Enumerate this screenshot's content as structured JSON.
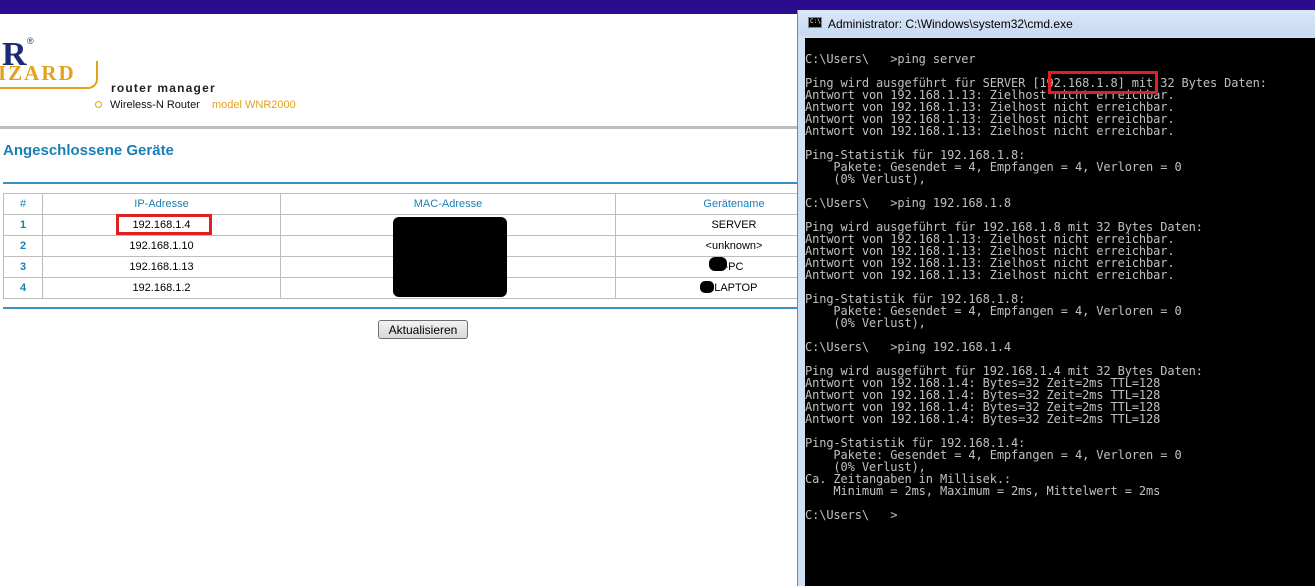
{
  "router": {
    "logo": {
      "brand_fragment": "R",
      "reg_mark": "®",
      "wizard": "IZARD"
    },
    "header": {
      "title": "router manager",
      "product": "Wireless-N Router",
      "model": "model WNR2000"
    },
    "page_title": "Angeschlossene Geräte",
    "table": {
      "headers": [
        "#",
        "IP-Adresse",
        "MAC-Adresse",
        "Gerätename"
      ],
      "rows": [
        {
          "num": "1",
          "ip": "192.168.1.4",
          "mac": "",
          "name": "SERVER"
        },
        {
          "num": "2",
          "ip": "192.168.1.10",
          "mac": "",
          "name": "<unknown>"
        },
        {
          "num": "3",
          "ip": "192.168.1.13",
          "mac": "",
          "name": "-PC"
        },
        {
          "num": "4",
          "ip": "192.168.1.2",
          "mac": "",
          "name": "-LAPTOP"
        }
      ]
    },
    "refresh_label": "Aktualisieren",
    "colors": {
      "accent_blue": "#1a7fb5",
      "wizard_orange": "#e3a21a",
      "top_bar": "#2b0c8c",
      "highlight_red": "#e02020"
    }
  },
  "cmd": {
    "title": "Administrator: C:\\Windows\\system32\\cmd.exe",
    "icon": "cmd-icon",
    "lines": [
      "C:\\Users\\   >ping server",
      "",
      "Ping wird ausgeführt für SERVER [192.168.1.8] mit 32 Bytes Daten:",
      "Antwort von 192.168.1.13: Zielhost nicht erreichbar.",
      "Antwort von 192.168.1.13: Zielhost nicht erreichbar.",
      "Antwort von 192.168.1.13: Zielhost nicht erreichbar.",
      "Antwort von 192.168.1.13: Zielhost nicht erreichbar.",
      "",
      "Ping-Statistik für 192.168.1.8:",
      "    Pakete: Gesendet = 4, Empfangen = 4, Verloren = 0",
      "    (0% Verlust),",
      "",
      "C:\\Users\\   >ping 192.168.1.8",
      "",
      "Ping wird ausgeführt für 192.168.1.8 mit 32 Bytes Daten:",
      "Antwort von 192.168.1.13: Zielhost nicht erreichbar.",
      "Antwort von 192.168.1.13: Zielhost nicht erreichbar.",
      "Antwort von 192.168.1.13: Zielhost nicht erreichbar.",
      "Antwort von 192.168.1.13: Zielhost nicht erreichbar.",
      "",
      "Ping-Statistik für 192.168.1.8:",
      "    Pakete: Gesendet = 4, Empfangen = 4, Verloren = 0",
      "    (0% Verlust),",
      "",
      "C:\\Users\\   >ping 192.168.1.4",
      "",
      "Ping wird ausgeführt für 192.168.1.4 mit 32 Bytes Daten:",
      "Antwort von 192.168.1.4: Bytes=32 Zeit=2ms TTL=128",
      "Antwort von 192.168.1.4: Bytes=32 Zeit=2ms TTL=128",
      "Antwort von 192.168.1.4: Bytes=32 Zeit=2ms TTL=128",
      "Antwort von 192.168.1.4: Bytes=32 Zeit=2ms TTL=128",
      "",
      "Ping-Statistik für 192.168.1.4:",
      "    Pakete: Gesendet = 4, Empfangen = 4, Verloren = 0",
      "    (0% Verlust),",
      "Ca. Zeitangaben in Millisek.:",
      "    Minimum = 2ms, Maximum = 2ms, Mittelwert = 2ms",
      "",
      "C:\\Users\\   >"
    ]
  }
}
